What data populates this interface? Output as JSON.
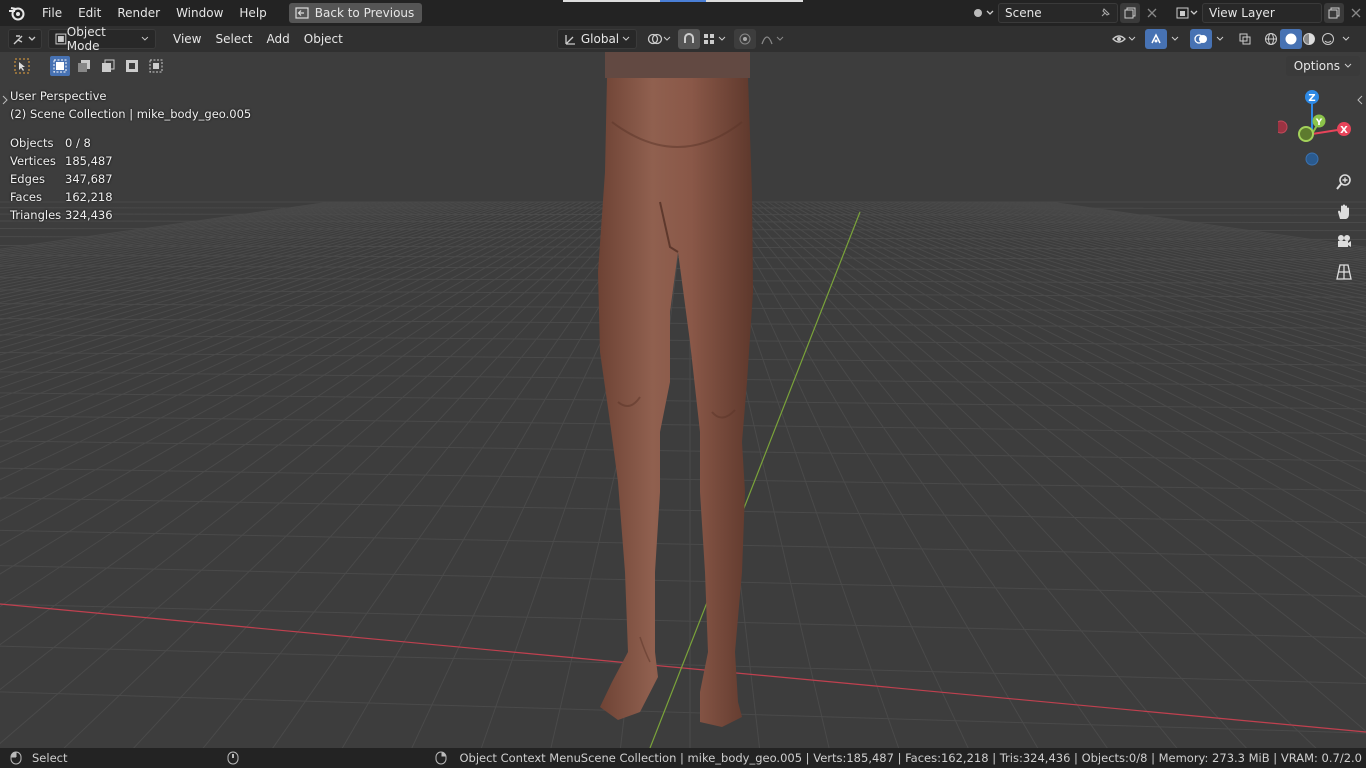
{
  "menu": {
    "items": [
      "File",
      "Edit",
      "Render",
      "Window",
      "Help"
    ],
    "back_button": "Back to Previous"
  },
  "scene": {
    "name": "Scene",
    "view_layer": "View Layer"
  },
  "header": {
    "mode": "Object Mode",
    "menus": [
      "View",
      "Select",
      "Add",
      "Object"
    ],
    "transform_orientation": "Global",
    "options_label": "Options"
  },
  "viewport": {
    "perspective": "User Perspective",
    "collection_line": "(2) Scene Collection | mike_body_geo.005",
    "stats": [
      {
        "label": "Objects",
        "value": "0 / 8"
      },
      {
        "label": "Vertices",
        "value": "185,487"
      },
      {
        "label": "Edges",
        "value": "347,687"
      },
      {
        "label": "Faces",
        "value": "162,218"
      },
      {
        "label": "Triangles",
        "value": "324,436"
      }
    ],
    "gizmo": {
      "z": "Z",
      "y": "Y",
      "x": "X"
    }
  },
  "status": {
    "left_action": "Select",
    "middle_action": "Object Context Menu",
    "right_info": "Scene Collection | mike_body_geo.005 | Verts:185,487 | Faces:162,218 | Tris:324,436 | Objects:0/8 | Memory: 273.3 MiB | VRAM: 0.7/2.0"
  },
  "colors": {
    "accent": "#4772b3",
    "x_axis": "#e8445a",
    "y_axis": "#8bc34a",
    "z_axis": "#2e8ae6",
    "skin": "#8a5747"
  }
}
